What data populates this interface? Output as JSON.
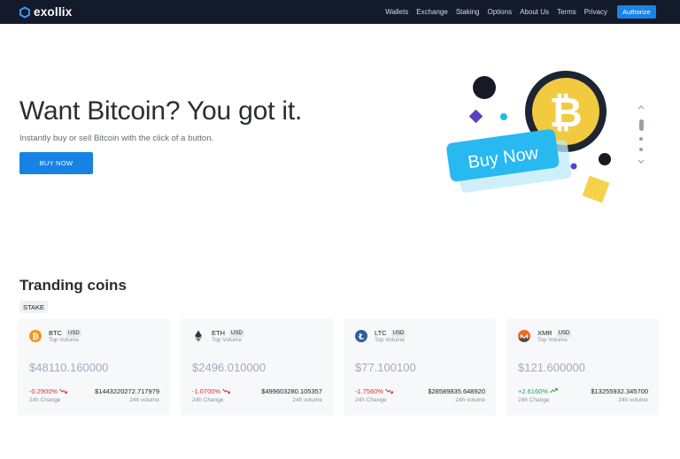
{
  "nav": {
    "logo": "exollix",
    "links": [
      "Wallets",
      "Exchange",
      "Staking",
      "Options",
      "About Us",
      "Terms",
      "Privacy"
    ],
    "authorize": "Authorize"
  },
  "hero": {
    "title": "Want Bitcoin? You got it.",
    "subtitle": "Instantly buy or sell Bitcoin with the click of a button.",
    "cta": "BUY NOW",
    "illustration_label": "Buy Now"
  },
  "trending": {
    "title": "Tranding coins",
    "tag": "STAKE",
    "cards": [
      {
        "symbol": "BTC",
        "quote": "USD",
        "subtitle": "Top Volume",
        "price": "$48110.160000",
        "change": "-0.2900%",
        "change_label": "24h Change",
        "volume": "$1443220272.717979",
        "volume_label": "24h volume",
        "icon_color": "#f7931a"
      },
      {
        "symbol": "ETH",
        "quote": "USD",
        "subtitle": "Top Volume",
        "price": "$2496.010000",
        "change": "-1.0700%",
        "change_label": "24h Change",
        "volume": "$499603280.105357",
        "volume_label": "24h volume",
        "icon_color": "#343434"
      },
      {
        "symbol": "LTC",
        "quote": "USD",
        "subtitle": "Top Volume",
        "price": "$77.100100",
        "change": "-1.7560%",
        "change_label": "24h Change",
        "volume": "$28589835.648920",
        "volume_label": "24h volume",
        "icon_color": "#345d9d"
      },
      {
        "symbol": "XMR",
        "quote": "USD",
        "subtitle": "Top Volume",
        "price": "$121.600000",
        "change": "+2.6160%",
        "change_label": "24h Change",
        "volume": "$13255932.345700",
        "volume_label": "24h volume",
        "icon_color": "#f26822"
      }
    ]
  },
  "colors": {
    "nav_bg": "#131a2a",
    "accent": "#1683e4",
    "negative": "#e0302f",
    "positive": "#22a35a"
  }
}
